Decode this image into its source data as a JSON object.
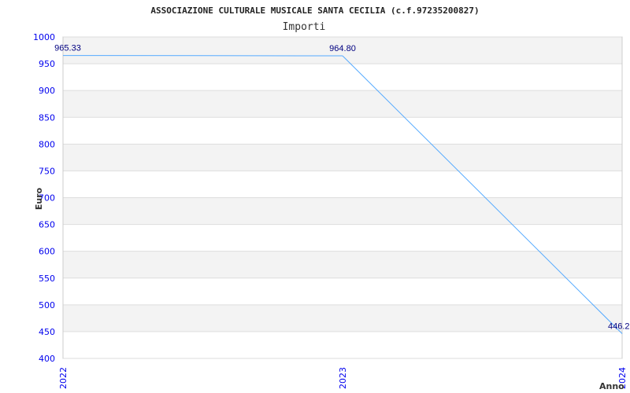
{
  "chart_data": {
    "type": "line",
    "title": "ASSOCIAZIONE CULTURALE MUSICALE SANTA CECILIA (c.f.97235200827)",
    "subtitle": "Importi",
    "xlabel": "Anno",
    "ylabel": "Euro",
    "ylim": [
      400,
      1000
    ],
    "yticks": [
      "400",
      "450",
      "500",
      "550",
      "600",
      "650",
      "700",
      "750",
      "800",
      "850",
      "900",
      "950",
      "1000"
    ],
    "categories": [
      "2022",
      "2023",
      "2024"
    ],
    "values": [
      965.33,
      964.8,
      446.2
    ],
    "data_labels": [
      "965.33",
      "964.80",
      "446.2"
    ],
    "grid": true,
    "colors": {
      "line": "#55aaff",
      "band": "#f3f3f3",
      "grid": "#dddddd",
      "tick": "#0000ee",
      "label": "#000080"
    }
  }
}
